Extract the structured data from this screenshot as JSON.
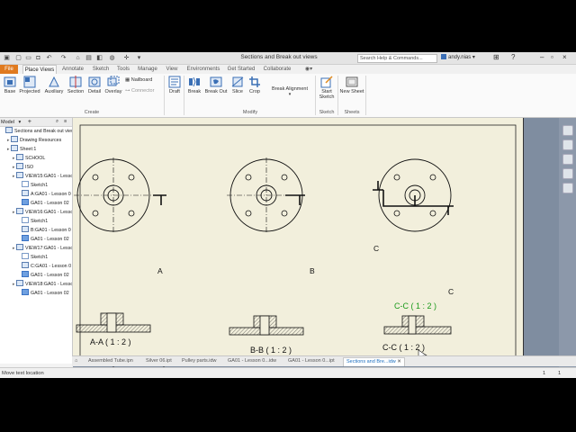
{
  "app": {
    "document_title": "Sections and Break out views",
    "search_placeholder": "Search Help & Commands...",
    "user": "andy.nias"
  },
  "ribbon": {
    "tabs": [
      "File",
      "Place Views",
      "Annotate",
      "Sketch",
      "Tools",
      "Manage",
      "View",
      "Environments",
      "Get Started",
      "Collaborate"
    ],
    "active_tab": "Place Views",
    "create": {
      "group_label": "Create",
      "base": "Base",
      "projected": "Projected",
      "auxiliary": "Auxiliary",
      "section": "Section",
      "detail": "Detail",
      "overlay": "Overlay",
      "nailboard": "Nailboard",
      "connector": "Connector"
    },
    "modify": {
      "group_label": "Modify",
      "draft": "Draft",
      "break": "Break",
      "break_out": "Break Out",
      "slice": "Slice",
      "crop": "Crop",
      "break_alignment": "Break Alignment"
    },
    "sketch": {
      "group_label": "Sketch",
      "start_sketch": "Start Sketch"
    },
    "sheets": {
      "group_label": "Sheets",
      "new_sheet": "New Sheet"
    }
  },
  "browser": {
    "header": "Model",
    "nodes": [
      {
        "label": "Sections and Break out views",
        "level": 0
      },
      {
        "label": "Drawing Resources",
        "level": 1
      },
      {
        "label": "Sheet:1",
        "level": 1
      },
      {
        "label": "SCHOOL",
        "level": 2
      },
      {
        "label": "ISO",
        "level": 2
      },
      {
        "label": "VIEW15:GA01 - Lesson",
        "level": 2
      },
      {
        "label": "Sketch1",
        "level": 3
      },
      {
        "label": "A:GA01 - Lesson 0",
        "level": 3
      },
      {
        "label": "GA01 - Lesson 02",
        "level": 3
      },
      {
        "label": "VIEW16:GA01 - Lesson",
        "level": 2
      },
      {
        "label": "Sketch1",
        "level": 3
      },
      {
        "label": "B:GA01 - Lesson 0",
        "level": 3
      },
      {
        "label": "GA01 - Lesson 02",
        "level": 3
      },
      {
        "label": "VIEW17:GA01 - Lesson",
        "level": 2
      },
      {
        "label": "Sketch1",
        "level": 3
      },
      {
        "label": "C:GA01 - Lesson 0",
        "level": 3
      },
      {
        "label": "GA01 - Lesson 02",
        "level": 3
      },
      {
        "label": "VIEW18:GA01 - Lesson",
        "level": 2
      },
      {
        "label": "GA01 - Lesson 02",
        "level": 3
      }
    ]
  },
  "drawing": {
    "view_a_label": "A-A ( 1 : 2 )",
    "view_b_label": "B-B ( 1 : 2 )",
    "view_c_label_green": "C-C ( 1 : 2 )",
    "view_c_label": "C-C ( 1 : 2 )",
    "marker_a": "A",
    "marker_b": "B",
    "marker_c": "C",
    "colors": {
      "sheet": "#f2efdc",
      "highlight": "#1a9a1a",
      "background": "#7f8da0"
    }
  },
  "document_tabs": [
    {
      "label": "Assembled Tube.ipn",
      "active": false
    },
    {
      "label": "Silver 06.ipt",
      "active": false
    },
    {
      "label": "Pulley parts.idw",
      "active": false
    },
    {
      "label": "GA01 - Lesson 0...idw",
      "active": false
    },
    {
      "label": "GA01 - Lesson 0...ipt",
      "active": false
    },
    {
      "label": "Sections and Bre...idw",
      "active": true
    }
  ],
  "status": {
    "message": "Move text location",
    "count1": "1",
    "count2": "1"
  }
}
